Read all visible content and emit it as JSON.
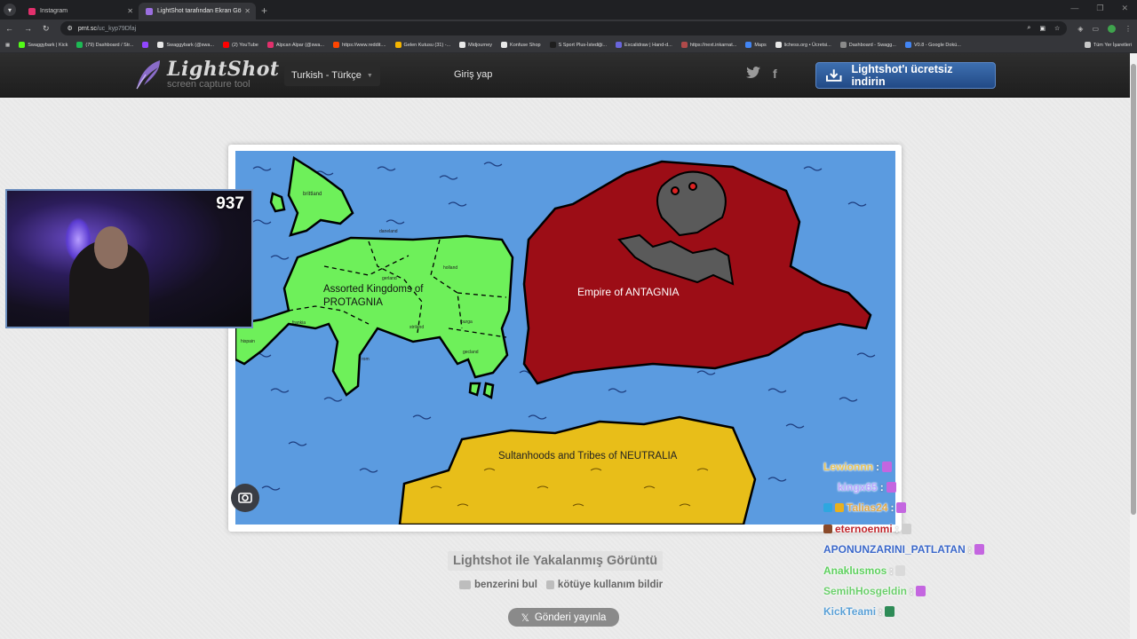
{
  "browser": {
    "tabs": [
      {
        "title": "Instagram",
        "icon_color": "#e1306c"
      },
      {
        "title": "LightShot tarafından Ekran Gö",
        "icon_color": "#9b6fe0"
      }
    ],
    "url_host": "prnt.sc",
    "url_path": "/uc_kyp79Dfaj",
    "bookmarks": [
      {
        "label": "Swaggybark | Kick",
        "color": "#53fc18"
      },
      {
        "label": "(79) Dashboard / Str...",
        "color": "#1db954"
      },
      {
        "label": "",
        "color": "#9146ff"
      },
      {
        "label": "Swaggybark (@swa...",
        "color": "#e8e8e8"
      },
      {
        "label": "(2) YouTube",
        "color": "#ff0000"
      },
      {
        "label": "Alpcan Alpar (@swa...",
        "color": "#e1306c"
      },
      {
        "label": "https://www.reddit....",
        "color": "#ff4500"
      },
      {
        "label": "Gelen Kutusu (31) -...",
        "color": "#f4b400"
      },
      {
        "label": "Midjourney",
        "color": "#e8e8e8"
      },
      {
        "label": "Konfuse Shop",
        "color": "#e8e8e8"
      },
      {
        "label": "S Sport Plus-İstediği...",
        "color": "#1e1e1e"
      },
      {
        "label": "Excalidraw | Hand-d...",
        "color": "#6965db"
      },
      {
        "label": "https://next.inkarnat...",
        "color": "#b04a4a"
      },
      {
        "label": "Maps",
        "color": "#4285f4"
      },
      {
        "label": "lichess.org • Ücretsi...",
        "color": "#e8e8e8"
      },
      {
        "label": "Dashboard - Swagg...",
        "color": "#8a8a8a"
      },
      {
        "label": "V0.8 - Google Dokü...",
        "color": "#4285f4"
      }
    ],
    "bookmarks_folder": "Tüm Yer İşaretleri"
  },
  "header": {
    "logo_title": "LightShot",
    "logo_sub": "screen capture tool",
    "language": "Turkish - Türkçe",
    "login": "Giriş yap",
    "social": [
      "twitter-icon",
      "facebook-icon"
    ],
    "download_button": "Lightshot'ı ücretsiz indirin"
  },
  "screenshot": {
    "map_labels": {
      "brittland": "brittland",
      "daneland": "daneland",
      "gerland": "gerland",
      "holland": "holland",
      "protagnia": "Assorted Kingdoms of",
      "protagnia2": "PROTAGNIA",
      "frankia": "frankia",
      "hispain": "hispain",
      "rom": "rom",
      "striland": "striland",
      "burga": "burga",
      "gecland": "gecland",
      "antagnia": "Empire of ANTAGNIA",
      "neutralia": "Sultanhoods and Tribes of NEUTRALIA"
    },
    "colors": {
      "sea": "#5b9be0",
      "protagnia": "#6ef05a",
      "antagnia": "#9c0d16",
      "neutralia": "#e8be19",
      "skull": "#5a5a5a"
    }
  },
  "webcam": {
    "viewer_count": "937"
  },
  "page": {
    "caption": "Lightshot ile Yakalanmış Görüntü",
    "similar": "benzerini bul",
    "report": "kötüye kullanım bildir",
    "post": "Gönderi yayınla"
  },
  "chat": [
    {
      "user": "Lewionnn",
      "color": "#e8c35a",
      "emote_color": "#c466e0"
    },
    {
      "user": "kingx65",
      "color": "#b9a6ff",
      "emote_color": "#c466e0"
    },
    {
      "user": "Talias24",
      "color": "#e0a84a",
      "emote_color": "#c466e0"
    },
    {
      "user": "eternoenmi",
      "color": "#c1272d",
      "emote_color": "#cfcfcf"
    },
    {
      "user": "APONUNZARINI_PATLATAN",
      "color": "#3a67c9",
      "emote_color": "#c466e0"
    },
    {
      "user": "Anaklusmos",
      "color": "#5fd05f",
      "emote_color": "#dadada"
    },
    {
      "user": "SemihHosgeldin",
      "color": "#6ccf6c",
      "emote_color": "#c466e0"
    },
    {
      "user": "KickTeami",
      "color": "#5aa0d6",
      "emote_color": "#2e8b57"
    }
  ]
}
